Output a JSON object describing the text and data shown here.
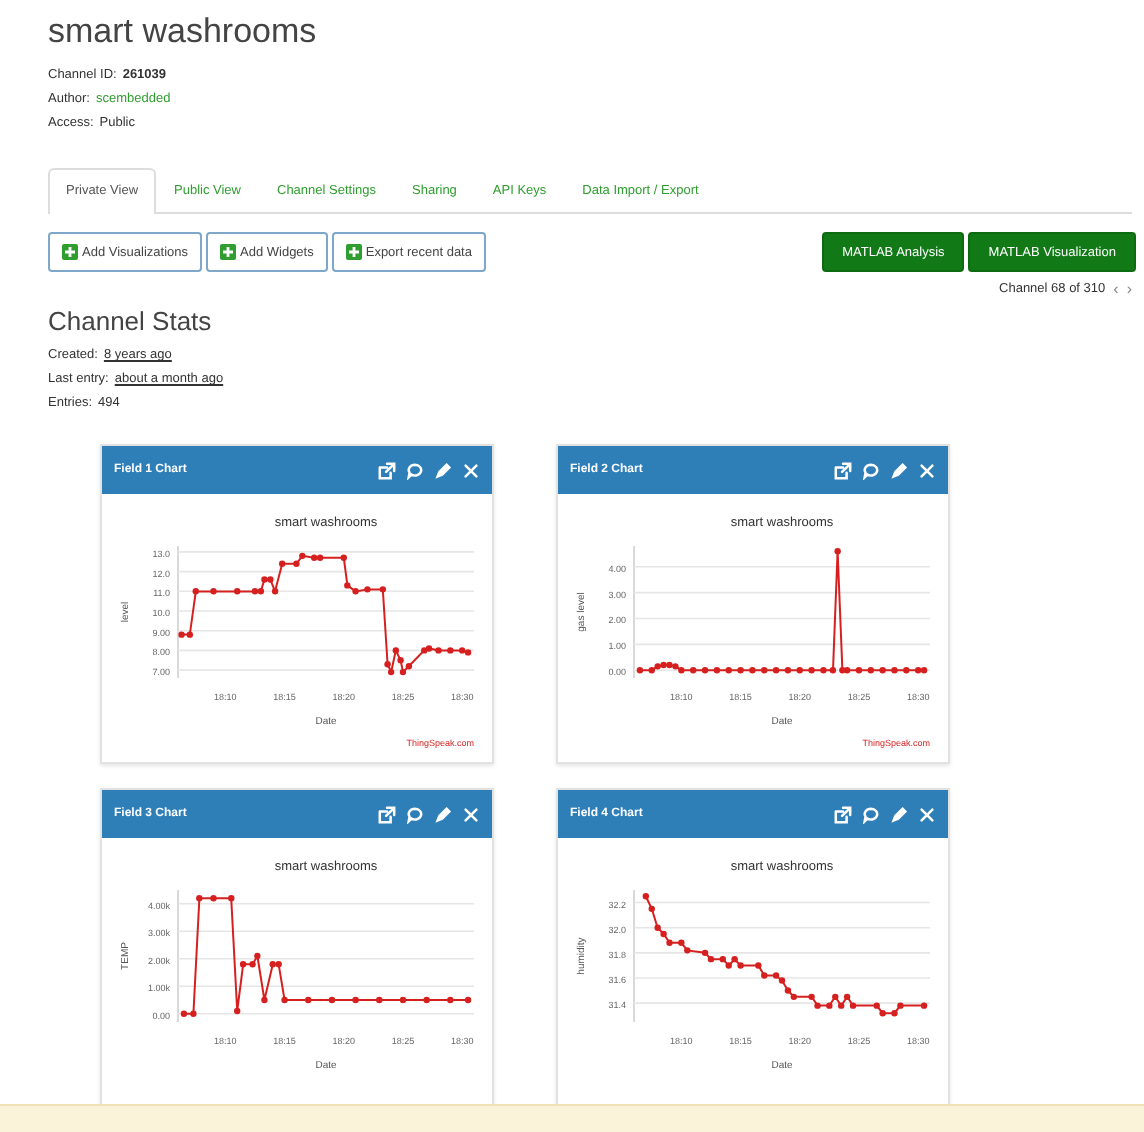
{
  "channel": {
    "title": "smart washrooms",
    "meta": [
      {
        "label": "Channel ID:",
        "value": "261039",
        "kind": "bold"
      },
      {
        "label": "Author:",
        "value": "scembedded",
        "kind": "link"
      },
      {
        "label": "Access:",
        "value": "Public",
        "kind": "plain"
      }
    ]
  },
  "tabs": [
    {
      "label": "Private View",
      "selected": true
    },
    {
      "label": "Public View",
      "selected": false
    },
    {
      "label": "Channel Settings",
      "selected": false
    },
    {
      "label": "Sharing",
      "selected": false
    },
    {
      "label": "API Keys",
      "selected": false
    },
    {
      "label": "Data Import / Export",
      "selected": false
    }
  ],
  "actions": [
    {
      "label": "Add Visualizations",
      "kind": "outline"
    },
    {
      "label": "Add Widgets",
      "kind": "outline"
    },
    {
      "label": "Export recent data",
      "kind": "outline"
    },
    {
      "label": "MATLAB Analysis",
      "kind": "primary"
    },
    {
      "label": "MATLAB Visualization",
      "kind": "primary"
    }
  ],
  "pager": {
    "text": "Channel 68 of 310",
    "prev": "‹",
    "next": "›"
  },
  "stats": {
    "title": "Channel Stats",
    "rows": [
      {
        "label": "Created:",
        "value": "8 years ago",
        "kind": "link"
      },
      {
        "label": "Last entry:",
        "value": "about a month ago",
        "kind": "link"
      },
      {
        "label": "Entries:",
        "value": "494",
        "kind": "plain"
      }
    ]
  },
  "charts": [
    {
      "header": "Field 1 Chart",
      "credit": "ThingSpeak.com",
      "chart_data": {
        "type": "line",
        "title": "smart washrooms",
        "xlabel": "Date",
        "ylabel": "level",
        "xlim": [
          1086,
          1111
        ],
        "ylim": [
          6.6,
          13.3
        ],
        "grid": true,
        "xticks": [
          {
            "value": 1090,
            "label": "18:10"
          },
          {
            "value": 1095,
            "label": "18:15"
          },
          {
            "value": 1100,
            "label": "18:20"
          },
          {
            "value": 1105,
            "label": "18:25"
          },
          {
            "value": 1110,
            "label": "18:30"
          }
        ],
        "yticks": [
          {
            "value": 13,
            "label": "13.0"
          },
          {
            "value": 12,
            "label": "12.0"
          },
          {
            "value": 11,
            "label": "11.0"
          },
          {
            "value": 10,
            "label": "10.0"
          },
          {
            "value": 9,
            "label": "9.00"
          },
          {
            "value": 8,
            "label": "8.00"
          },
          {
            "value": 7,
            "label": "7.00"
          }
        ],
        "x": [
          1086.3,
          1087,
          1087.5,
          1089,
          1091,
          1092.5,
          1093,
          1093.3,
          1093.8,
          1094.2,
          1094.8,
          1096,
          1096.5,
          1097.5,
          1098,
          1100,
          1100.3,
          1101,
          1102,
          1103.3,
          1103.7,
          1104,
          1104.4,
          1104.8,
          1105,
          1105.5,
          1106.8,
          1107.2,
          1108,
          1109,
          1110,
          1110.5
        ],
        "series": [
          {
            "color": "#d62020",
            "marker": "circle",
            "values": [
              8.8,
              8.8,
              11.0,
              11.0,
              11.0,
              11.0,
              11.0,
              11.6,
              11.6,
              11.0,
              12.4,
              12.4,
              12.8,
              12.7,
              12.7,
              12.7,
              11.3,
              11.0,
              11.1,
              11.1,
              7.3,
              6.9,
              8.0,
              7.5,
              6.9,
              7.2,
              8.0,
              8.1,
              8.0,
              8.0,
              8.0,
              7.9
            ]
          }
        ]
      }
    },
    {
      "header": "Field 2 Chart",
      "credit": "ThingSpeak.com",
      "chart_data": {
        "type": "line",
        "title": "smart washrooms",
        "xlabel": "Date",
        "ylabel": "gas level",
        "xlim": [
          1086,
          1111
        ],
        "ylim": [
          -0.3,
          4.8
        ],
        "grid": true,
        "xticks": [
          {
            "value": 1090,
            "label": "18:10"
          },
          {
            "value": 1095,
            "label": "18:15"
          },
          {
            "value": 1100,
            "label": "18:20"
          },
          {
            "value": 1105,
            "label": "18:25"
          },
          {
            "value": 1110,
            "label": "18:30"
          }
        ],
        "yticks": [
          {
            "value": 4,
            "label": "4.00"
          },
          {
            "value": 3,
            "label": "3.00"
          },
          {
            "value": 2,
            "label": "2.00"
          },
          {
            "value": 1,
            "label": "1.00"
          },
          {
            "value": 0,
            "label": "0.00"
          }
        ],
        "x": [
          1086.5,
          1087.5,
          1088,
          1088.5,
          1089,
          1089.5,
          1090,
          1091,
          1092,
          1093,
          1094,
          1095,
          1096,
          1097,
          1098,
          1099,
          1100,
          1101,
          1102,
          1102.8,
          1103.2,
          1103.6,
          1104,
          1105,
          1106,
          1107,
          1108,
          1109,
          1110,
          1110.5
        ],
        "series": [
          {
            "color": "#d62020",
            "marker": "circle",
            "values": [
              0,
              0,
              0.15,
              0.2,
              0.2,
              0.15,
              0,
              0,
              0,
              0,
              0,
              0,
              0,
              0,
              0,
              0,
              0,
              0,
              0,
              0,
              4.6,
              0,
              0,
              0,
              0,
              0,
              0,
              0,
              0,
              0
            ]
          }
        ]
      }
    },
    {
      "header": "Field 3 Chart",
      "chart_data": {
        "type": "line",
        "title": "smart washrooms",
        "xlabel": "Date",
        "ylabel": "TEMP",
        "xlim": [
          1086,
          1111
        ],
        "ylim": [
          -300,
          4500
        ],
        "grid": true,
        "xticks": [
          {
            "value": 1090,
            "label": "18:10"
          },
          {
            "value": 1095,
            "label": "18:15"
          },
          {
            "value": 1100,
            "label": "18:20"
          },
          {
            "value": 1105,
            "label": "18:25"
          },
          {
            "value": 1110,
            "label": "18:30"
          }
        ],
        "yticks": [
          {
            "value": 4000,
            "label": "4.00k"
          },
          {
            "value": 3000,
            "label": "3.00k"
          },
          {
            "value": 2000,
            "label": "2.00k"
          },
          {
            "value": 1000,
            "label": "1.00k"
          },
          {
            "value": 0,
            "label": "0.00"
          }
        ],
        "x": [
          1086.5,
          1087.3,
          1087.8,
          1089,
          1090.5,
          1091,
          1091.5,
          1092.3,
          1092.7,
          1093.3,
          1094,
          1094.5,
          1095,
          1097,
          1099,
          1101,
          1103,
          1105,
          1107,
          1109,
          1110.5
        ],
        "series": [
          {
            "color": "#d62020",
            "marker": "circle",
            "values": [
              0,
              0,
              4200,
              4200,
              4200,
              100,
              1800,
              1800,
              2100,
              500,
              1800,
              1800,
              500,
              500,
              500,
              500,
              500,
              500,
              500,
              500,
              500
            ]
          }
        ]
      }
    },
    {
      "header": "Field 4 Chart",
      "chart_data": {
        "type": "line",
        "title": "smart washrooms",
        "xlabel": "Date",
        "ylabel": "humidity",
        "xlim": [
          1086,
          1111
        ],
        "ylim": [
          31.25,
          32.3
        ],
        "grid": true,
        "xticks": [
          {
            "value": 1090,
            "label": "18:10"
          },
          {
            "value": 1095,
            "label": "18:15"
          },
          {
            "value": 1100,
            "label": "18:20"
          },
          {
            "value": 1105,
            "label": "18:25"
          },
          {
            "value": 1110,
            "label": "18:30"
          }
        ],
        "yticks": [
          {
            "value": 32.2,
            "label": "32.2"
          },
          {
            "value": 32,
            "label": "32.0"
          },
          {
            "value": 31.8,
            "label": "31.8"
          },
          {
            "value": 31.6,
            "label": "31.6"
          },
          {
            "value": 31.4,
            "label": "31.4"
          }
        ],
        "x": [
          1087,
          1087.5,
          1088,
          1088.5,
          1089,
          1090,
          1090.5,
          1092,
          1092.5,
          1093.5,
          1094,
          1094.5,
          1095,
          1096.5,
          1097,
          1098,
          1098.5,
          1099,
          1099.5,
          1101,
          1101.5,
          1102.5,
          1103,
          1103.5,
          1104,
          1104.5,
          1106.5,
          1107,
          1108,
          1108.5,
          1110.5
        ],
        "series": [
          {
            "color": "#d62020",
            "marker": "circle",
            "values": [
              32.25,
              32.15,
              32.0,
              31.95,
              31.88,
              31.88,
              31.82,
              31.8,
              31.75,
              31.75,
              31.7,
              31.75,
              31.7,
              31.7,
              31.62,
              31.62,
              31.58,
              31.5,
              31.45,
              31.45,
              31.38,
              31.38,
              31.45,
              31.38,
              31.45,
              31.38,
              31.38,
              31.32,
              31.32,
              31.38,
              31.38
            ]
          }
        ]
      }
    }
  ]
}
